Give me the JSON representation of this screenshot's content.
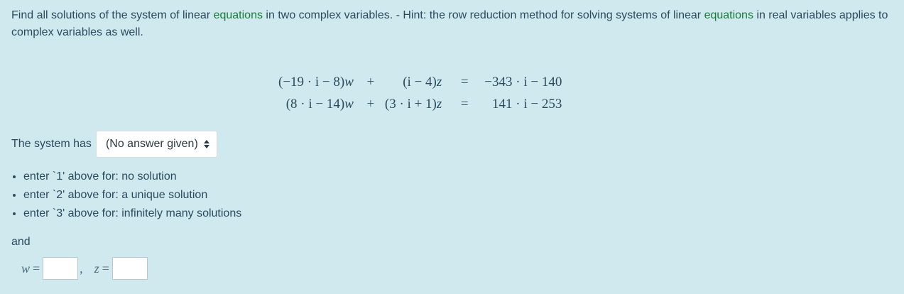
{
  "question": {
    "intro_part1": "Find all solutions of the system of linear ",
    "intro_kw1": "equations",
    "intro_part2": " in two complex variables. - Hint: the row reduction method for solving systems of linear ",
    "intro_kw2": "equations",
    "intro_part3": " in real variables applies to complex variables as well."
  },
  "system": {
    "rows": [
      {
        "lhs_w": "(−19 · i − 8)",
        "w_var": "w",
        "op": "+",
        "lhs_z": "(i − 4)",
        "z_var": "z",
        "eq": "=",
        "rhs": "−343 · i − 140"
      },
      {
        "lhs_w": "(8 · i − 14)",
        "w_var": "w",
        "op": "+",
        "lhs_z": "(3 · i + 1)",
        "z_var": "z",
        "eq": "=",
        "rhs": "141 · i − 253"
      }
    ]
  },
  "prompt": {
    "system_has_label": "The system has",
    "select_value": "(No answer given)",
    "select_icon": "up-down-arrows-icon"
  },
  "options": [
    "enter `1' above for: no solution",
    "enter `2' above for: a unique solution",
    "enter `3' above for: infinitely many solutions"
  ],
  "and_label": "and",
  "answers": {
    "w_label": "w",
    "z_label": "z",
    "equals": "=",
    "separator": ",",
    "w_value": "",
    "z_value": ""
  },
  "colors": {
    "background": "#cfe9ef",
    "text": "#2b4a5d",
    "keyword": "#1a7a3a"
  }
}
